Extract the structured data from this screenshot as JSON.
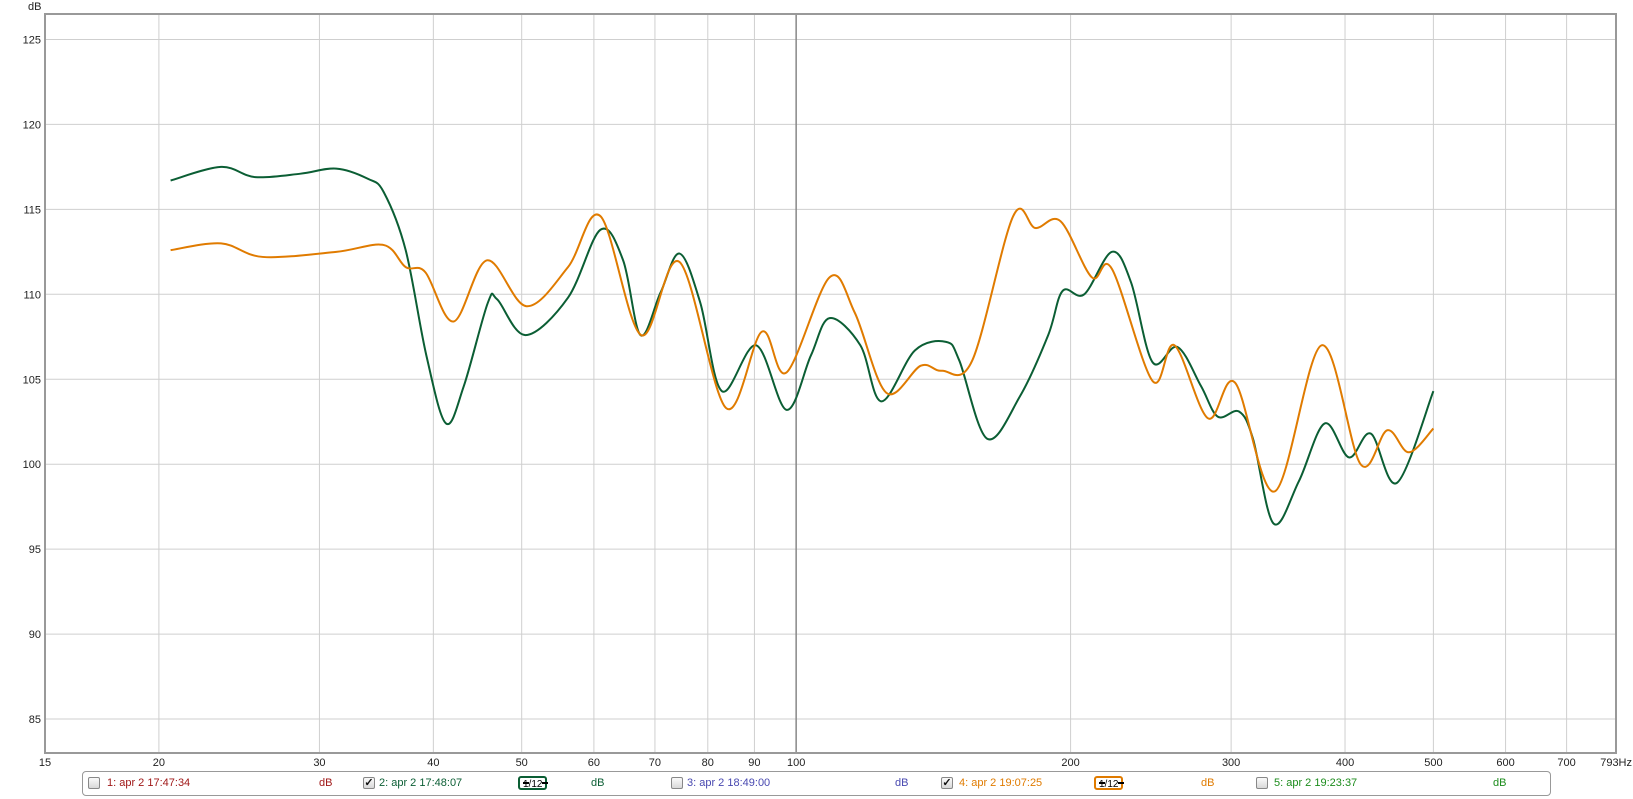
{
  "chart_data": {
    "type": "line",
    "ylabel": "dB",
    "xunit": "Hz",
    "xscale": "log",
    "xlim": [
      15,
      793
    ],
    "ylim": [
      83,
      126.5
    ],
    "grid": true,
    "yticks": [
      "125",
      "120",
      "115",
      "110",
      "105",
      "100",
      "95",
      "90",
      "85"
    ],
    "ytick_values": [
      125,
      120,
      115,
      110,
      105,
      100,
      95,
      90,
      85
    ],
    "xticks": [
      "15",
      "20",
      "30",
      "40",
      "50",
      "60",
      "70",
      "80",
      "90",
      "100",
      "200",
      "300",
      "400",
      "500",
      "600",
      "700",
      "793Hz"
    ],
    "xtick_values": [
      15,
      20,
      30,
      40,
      50,
      60,
      70,
      80,
      90,
      100,
      200,
      300,
      400,
      500,
      600,
      700,
      793
    ],
    "series": [
      {
        "name": "2: apr 2 17:48:07",
        "color": "#0b5e34",
        "x": [
          20.6,
          23.4,
          25.5,
          28.6,
          31.3,
          33.9,
          35.3,
          37.3,
          39.3,
          41.3,
          43.2,
          45.9,
          47,
          50.5,
          56.2,
          61,
          64.6,
          67.5,
          71,
          74.5,
          78.5,
          82.9,
          90.4,
          97.6,
          103.8,
          108.8,
          117.6,
          124,
          135,
          146,
          151,
          162,
          176,
          189,
          196,
          207,
          222,
          233,
          246,
          262,
          278,
          290,
          306,
          317,
          334,
          356,
          380,
          404,
          427,
          456,
          500
        ],
        "y": [
          116.7,
          117.5,
          116.9,
          117.1,
          117.4,
          116.8,
          116.0,
          112.6,
          106.4,
          102.4,
          104.6,
          109.5,
          109.7,
          107.6,
          109.8,
          113.8,
          112,
          107.6,
          110.1,
          112.4,
          109.5,
          104.3,
          107,
          103.2,
          106.4,
          108.6,
          107,
          103.7,
          106.7,
          107.2,
          106.1,
          101.5,
          104,
          107.6,
          110.2,
          110,
          112.5,
          110.7,
          106,
          106.9,
          104.6,
          102.8,
          103.1,
          101.5,
          96.5,
          99,
          102.4,
          100.4,
          101.8,
          98.9,
          104.3
        ]
      },
      {
        "name": "4: apr 2 19:07:25",
        "color": "#e07b00",
        "x": [
          20.6,
          23.4,
          26,
          31.3,
          35.3,
          37.3,
          39.2,
          42.1,
          45.8,
          50.6,
          56.2,
          61,
          67.6,
          74.5,
          83.8,
          91.7,
          97.6,
          108.8,
          116,
          125.6,
          137,
          144.5,
          156,
          173,
          183,
          195,
          211,
          222,
          246,
          260,
          283,
          303,
          335,
          377,
          416,
          445,
          470,
          500
        ],
        "y": [
          112.6,
          113,
          112.2,
          112.5,
          112.9,
          111.6,
          111.3,
          108.4,
          112,
          109.3,
          111.6,
          114.6,
          107.6,
          111.9,
          103.3,
          107.8,
          105.4,
          111,
          108.9,
          104.2,
          105.8,
          105.5,
          106.1,
          114.6,
          113.9,
          114.3,
          111,
          111.5,
          104.9,
          107,
          102.7,
          104.8,
          98.4,
          107,
          100,
          102,
          100.7,
          102.1
        ]
      }
    ],
    "legend": [
      {
        "label": "1: apr 2 17:47:34",
        "unit": "dB",
        "checked": false,
        "color": "#a01818",
        "smoothing": ""
      },
      {
        "label": "2: apr 2 17:48:07",
        "unit": "dB",
        "checked": true,
        "color": "#0b5e34",
        "smoothing": "1/12"
      },
      {
        "label": "3: apr 2 18:49:00",
        "unit": "dB",
        "checked": false,
        "color": "#4848b0",
        "smoothing": ""
      },
      {
        "label": "4: apr 2 19:07:25",
        "unit": "dB",
        "checked": true,
        "color": "#e07b00",
        "smoothing": "1/12"
      },
      {
        "label": "5: apr 2 19:23:37",
        "unit": "dB",
        "checked": false,
        "color": "#1c8c1c",
        "smoothing": ""
      }
    ],
    "check_mark": "✓"
  }
}
